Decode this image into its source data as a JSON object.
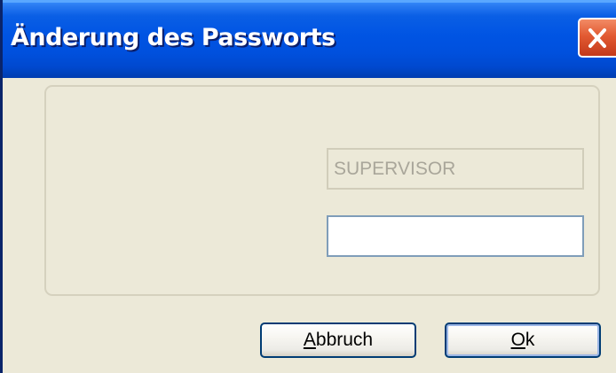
{
  "window": {
    "title": "Änderung des Passworts",
    "close_icon": "close-icon"
  },
  "form": {
    "username_value": "SUPERVISOR",
    "password_value": ""
  },
  "buttons": {
    "cancel_mnemonic": "A",
    "cancel_rest": "bbruch",
    "ok_mnemonic": "O",
    "ok_rest": "k"
  },
  "colors": {
    "titlebar": "#0054E3",
    "close_button": "#E25A32",
    "dialog_background": "#ECE9D8",
    "button_border": "#003C74"
  }
}
